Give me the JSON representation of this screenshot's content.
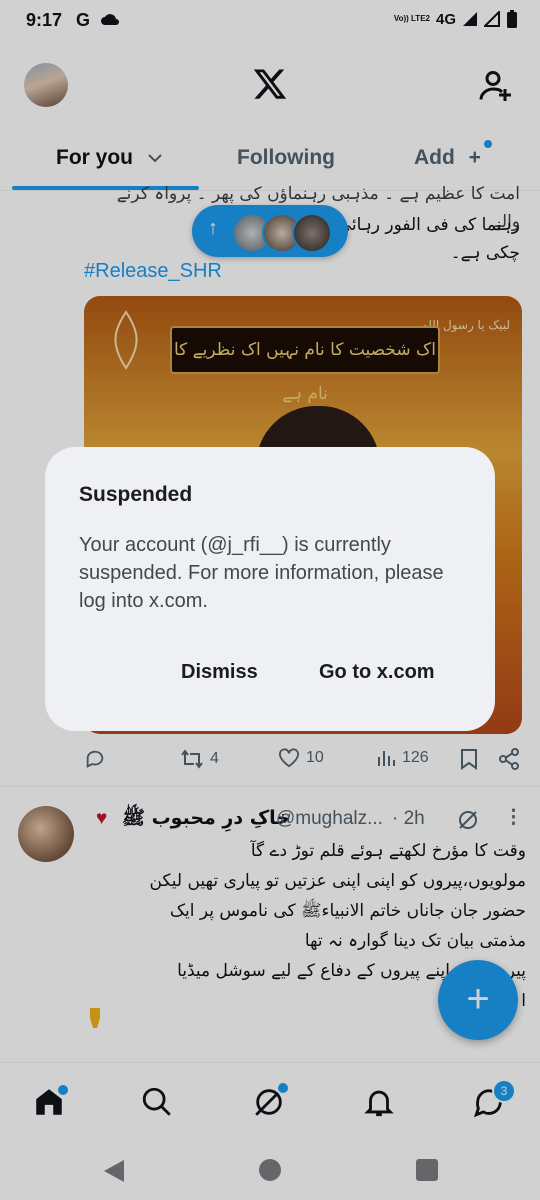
{
  "status_bar": {
    "time": "9:17",
    "g": "G",
    "network": "4G",
    "volte": "Vo)) LTE2"
  },
  "tabs": {
    "for_you": "For you",
    "following": "Following",
    "add": "Add"
  },
  "post1": {
    "line1": "امت کا عظیم ہے ۔ مذہبی رہنماؤں کی پھر ۔ پرواہ کرنے والے",
    "line2": "رہنما کی فی الفور رہائی           کی ضرورت بن",
    "line3": "چکی ہے۔",
    "hashtag": "#Release_SHR",
    "media_banner": "اک شخصیت کا نام نہیں  اک نظریے کا نام ہے",
    "media_corner": "لبیک یا رسول اللہ",
    "replies": "",
    "reposts": "4",
    "likes": "10",
    "views": "126"
  },
  "post2": {
    "name": "خاکِ درِ محبوب ﷺ",
    "handle": "@mughalz...",
    "time": "· 2h",
    "lines": [
      "وقت کا مؤرخ لکھتے ہوئے قلم توڑ دے گآ",
      "مولویوں،پیروں کو اپنی اپنی عزتیں تو پیاری تھیں لیکن",
      "حضور جان جاناں خاتم الانبیاءﷺ کی ناموس پر ایک",
      "مذمتی بیان تک دینا گوارہ نہ تھا",
      "پیر          ت اپنے اپنے پیروں کے دفاع کے لیے سوشل میڈیا",
      "ا"
    ]
  },
  "bottom_nav": {
    "messages_badge": "3"
  },
  "dialog": {
    "title": "Suspended",
    "message": "Your account (@j_rfi__) is currently suspended. For more information, please log into x.com.",
    "dismiss": "Dismiss",
    "go": "Go to x.com"
  },
  "colors": {
    "accent": "#1d9bf0",
    "dialog_bg": "#eff0f3"
  }
}
